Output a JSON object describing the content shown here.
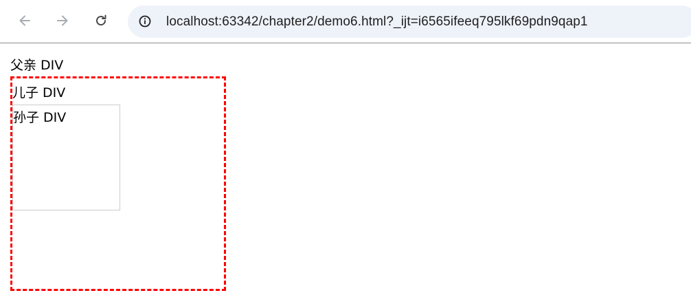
{
  "browser": {
    "back_icon": "arrow-left-icon",
    "forward_icon": "arrow-right-icon",
    "reload_icon": "reload-icon",
    "site_info_icon": "info-circle-icon",
    "url_host": "localhost",
    "url_rest": ":63342/chapter2/demo6.html?_ijt=i6565ifeeq795lkf69pdn9qap1"
  },
  "page": {
    "parent_label": "父亲 DIV",
    "son_label": "儿子 DIV",
    "grandson_label": "孙子 DIV",
    "son_border_color": "#ff0000",
    "grandson_border_color": "#cccccc"
  }
}
